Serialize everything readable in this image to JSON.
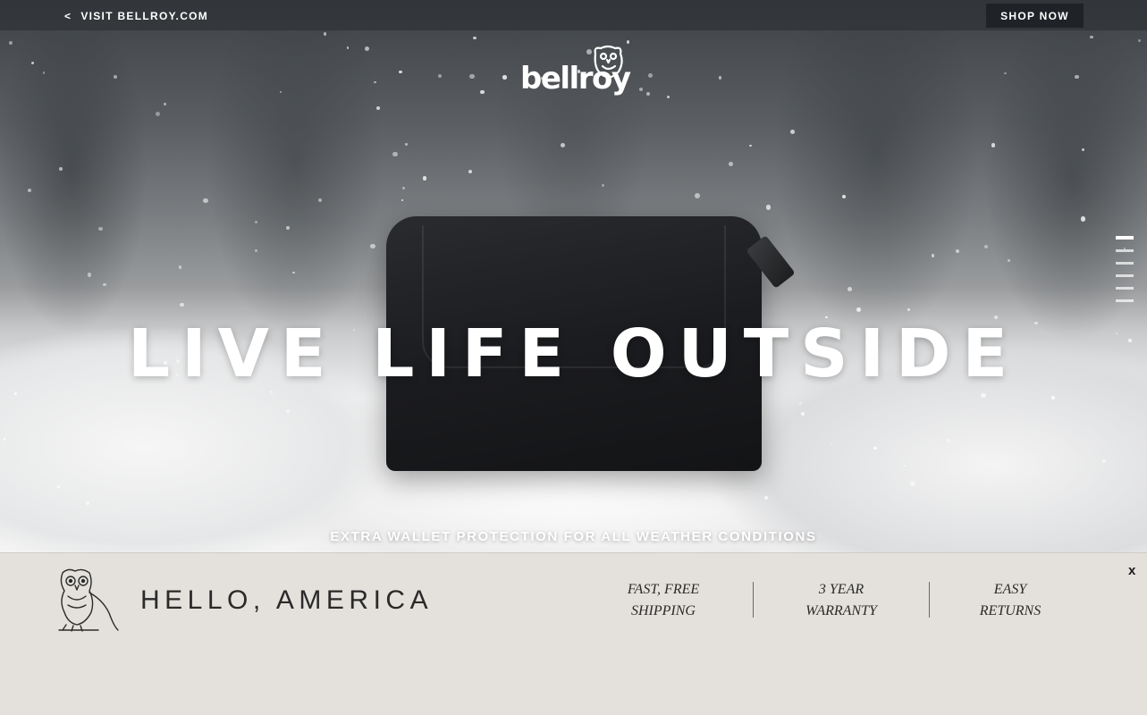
{
  "topbar": {
    "back_arrow": "<",
    "visit_label": "VISIT BELLROY.COM",
    "shop_label": "SHOP NOW"
  },
  "logo": {
    "text": "bellroy",
    "icon": "owl-icon"
  },
  "hero": {
    "title": "LIVE LIFE OUTSIDE",
    "subtitle": "EXTRA WALLET PROTECTION FOR ALL WEATHER CONDITIONS",
    "slides_total": 6,
    "active_slide": 1
  },
  "banner": {
    "greeting": "HELLO, AMERICA",
    "perks": [
      {
        "line1": "FAST, FREE",
        "line2": "SHIPPING"
      },
      {
        "line1": "3 YEAR",
        "line2": "WARRANTY"
      },
      {
        "line1": "EASY",
        "line2": "RETURNS"
      }
    ],
    "close_label": "x"
  },
  "colors": {
    "topbar_bg": "#282c30",
    "shop_button_bg": "#1f2328",
    "banner_bg": "#e4e1dc",
    "text_dark": "#2a2a2a"
  }
}
